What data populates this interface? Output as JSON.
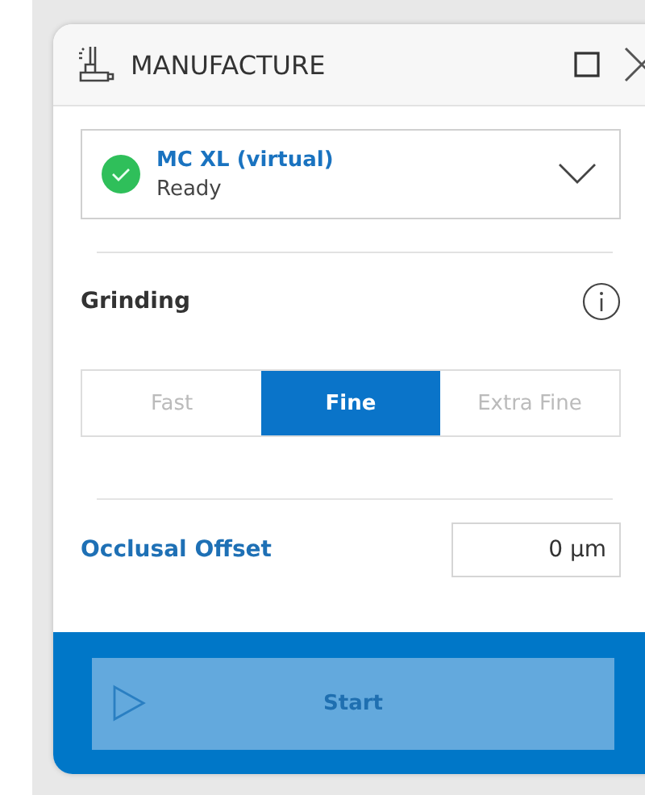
{
  "window": {
    "title": "MANUFACTURE"
  },
  "device": {
    "name": "MC XL (virtual)",
    "status": "Ready",
    "ready": true
  },
  "grinding": {
    "label": "Grinding",
    "options": [
      {
        "label": "Fast",
        "selected": false
      },
      {
        "label": "Fine",
        "selected": true
      },
      {
        "label": "Extra Fine",
        "selected": false
      }
    ]
  },
  "occlusal_offset": {
    "label": "Occlusal Offset",
    "value": "0 µm"
  },
  "start_button": {
    "label": "Start",
    "disabled": true
  }
}
